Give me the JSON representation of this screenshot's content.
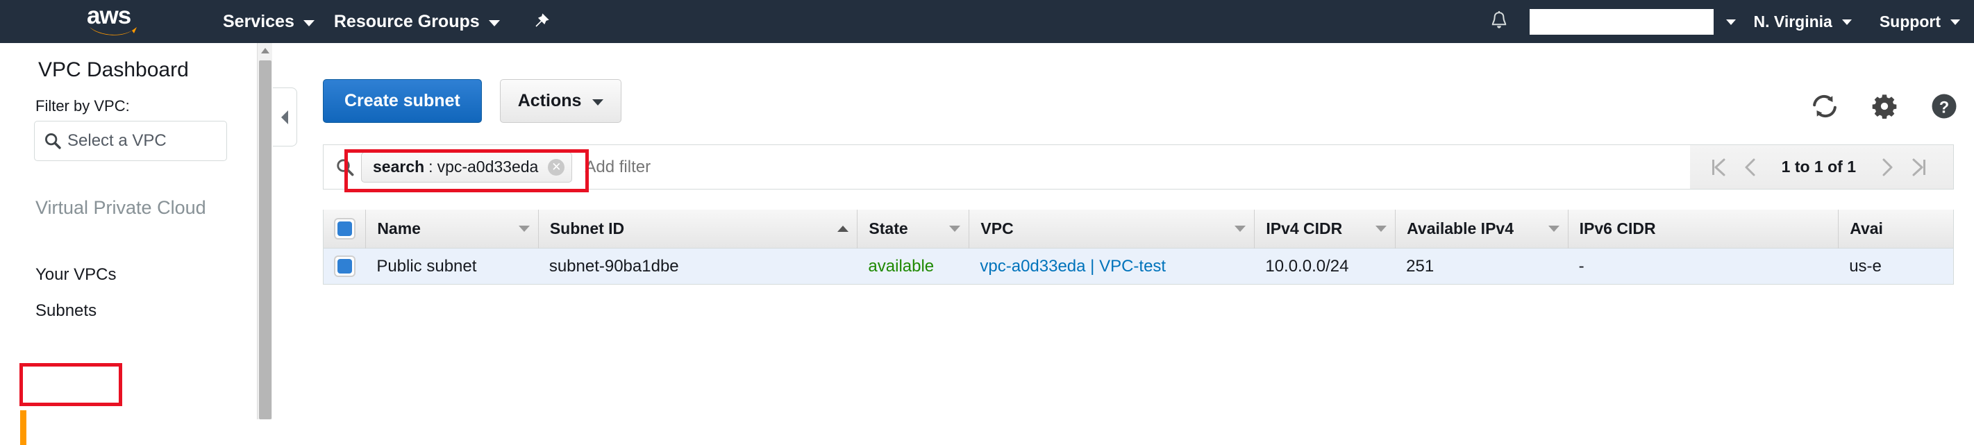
{
  "topnav": {
    "logo_text": "aws",
    "logo_icon": "aws-logo",
    "services_label": "Services",
    "resource_groups_label": "Resource Groups",
    "pin_icon": "pin-icon",
    "bell_icon": "bell-icon",
    "account_value": "",
    "region_label": "N. Virginia",
    "support_label": "Support"
  },
  "sidebar": {
    "title": "VPC Dashboard",
    "filter_label": "Filter by VPC:",
    "vpc_select_placeholder": "Select a VPC",
    "search_icon": "search-icon",
    "section_header": "Virtual Private Cloud",
    "items": [
      {
        "label": "Your VPCs",
        "active": false
      },
      {
        "label": "Subnets",
        "active": true
      }
    ],
    "scroll_up_icon": "chevron-up-icon",
    "collapse_icon": "chevron-left-icon"
  },
  "toolbar": {
    "create_label": "Create subnet",
    "actions_label": "Actions",
    "refresh_icon": "refresh-icon",
    "settings_icon": "gear-icon",
    "help_icon": "help-icon"
  },
  "filter": {
    "search_icon": "search-icon",
    "token_key": "search",
    "token_separator": ":",
    "token_value": "vpc-a0d33eda",
    "token_remove_icon": "close-icon",
    "placeholder": "Add filter"
  },
  "pagination": {
    "first_icon": "first-page-icon",
    "prev_icon": "prev-page-icon",
    "label": "1 to 1 of 1",
    "next_icon": "next-page-icon",
    "last_icon": "last-page-icon"
  },
  "table": {
    "select_all_checked": true,
    "columns": [
      {
        "label": "Name",
        "sort": "down"
      },
      {
        "label": "Subnet ID",
        "sort": "up"
      },
      {
        "label": "State",
        "sort": "down"
      },
      {
        "label": "VPC",
        "sort": "down"
      },
      {
        "label": "IPv4 CIDR",
        "sort": "down"
      },
      {
        "label": "Available IPv4",
        "sort": "down"
      },
      {
        "label": "IPv6 CIDR",
        "sort": "none"
      },
      {
        "label": "Avai",
        "sort": "none"
      }
    ],
    "rows": [
      {
        "checked": true,
        "name": "Public subnet",
        "subnet_id": "subnet-90ba1dbe",
        "state": "available",
        "vpc": "vpc-a0d33eda | VPC-test",
        "ipv4_cidr": "10.0.0.0/24",
        "available_ipv4": "251",
        "ipv6_cidr": "-",
        "availability_zone": "us-e"
      }
    ]
  },
  "colors": {
    "nav_background": "#232f3e",
    "primary_button": "#2f80d4",
    "link": "#0073bb",
    "state_available": "#1e8900",
    "annotation": "#e81123",
    "active_indicator": "#f90",
    "row_selected": "#eaf1fb"
  }
}
